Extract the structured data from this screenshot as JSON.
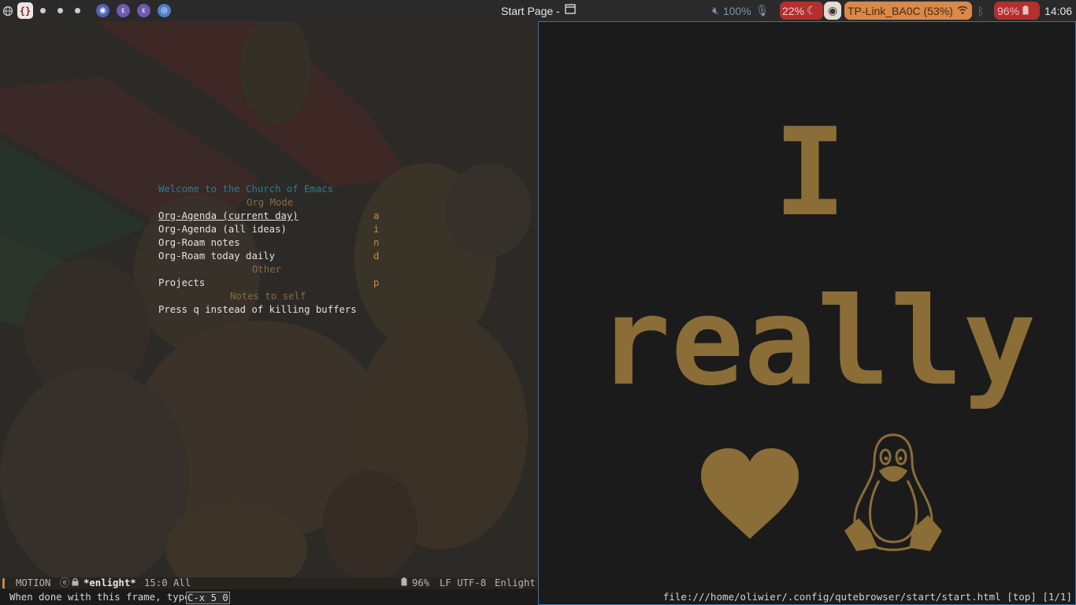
{
  "topbar": {
    "workspace_active": "{}",
    "window_title": "Start Page -",
    "volume": "100%",
    "brightness": "22%",
    "wifi": "TP-Link_BA0C (53%)",
    "battery": "96%",
    "clock": "14:06"
  },
  "emacs": {
    "welcome": "Welcome to the Church of Emacs",
    "sections": {
      "org_mode": "Org Mode",
      "other": "Other",
      "notes": "Notes to self"
    },
    "items": [
      {
        "label": "Org-Agenda (current day)",
        "key": "a"
      },
      {
        "label": "Org-Agenda (all ideas)",
        "key": "i"
      },
      {
        "label": "Org-Roam notes",
        "key": "n"
      },
      {
        "label": "Org-Roam today daily",
        "key": "d"
      },
      {
        "label": "Projects",
        "key": "p"
      }
    ],
    "note": "Press q instead of killing buffers",
    "modeline": {
      "state": "MOTION",
      "buffer": "*enlight*",
      "position": "15:0 All",
      "battery": "96%",
      "encoding": "LF UTF-8",
      "major_mode": "Enlight"
    },
    "echo": {
      "text": "When done with this frame, type",
      "keys": "C-x 5 0"
    }
  },
  "browser": {
    "line1": "I",
    "line2": "really",
    "statusbar": "file:///home/oliwier/.config/qutebrowser/start/start.html [top] [1/1]"
  },
  "colors": {
    "accent_gold": "#8a6d37",
    "emacs_teal": "#2e7b8f",
    "emacs_orange": "#c48b44",
    "browser_border": "#3874a8"
  }
}
